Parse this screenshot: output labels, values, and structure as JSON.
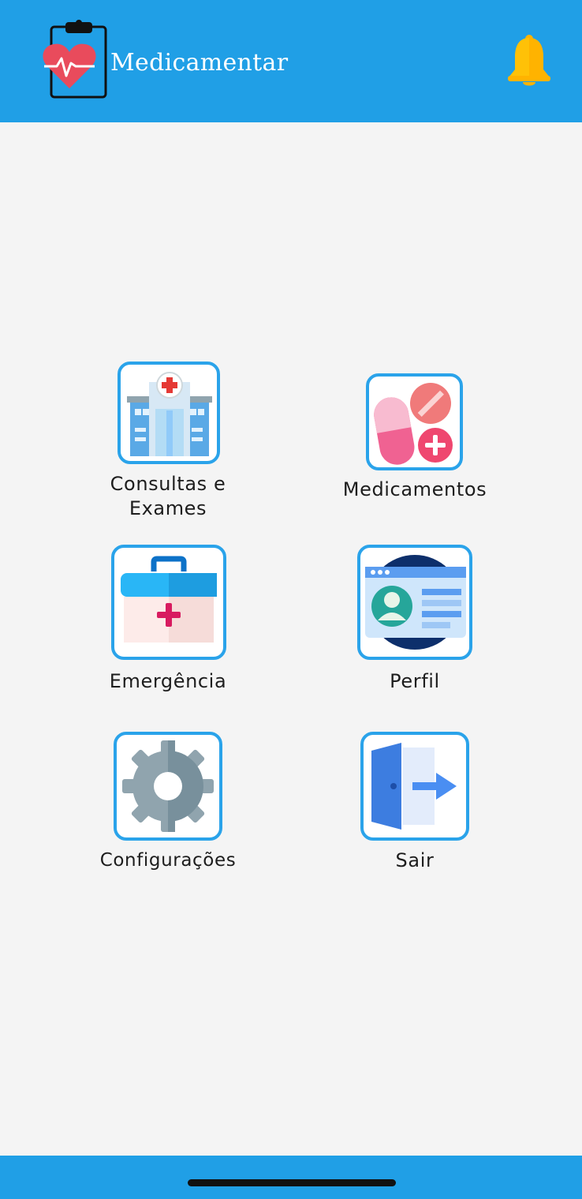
{
  "header": {
    "app_title": "Medicamentar",
    "logo_icon": "clipboard-heart-icon",
    "notification_icon": "bell-icon"
  },
  "menu": {
    "items": [
      {
        "label_line1": "Consultas e",
        "label_line2": "Exames",
        "icon": "hospital-icon"
      },
      {
        "label": "Medicamentos",
        "icon": "pills-icon"
      },
      {
        "label": "Emergência",
        "icon": "first-aid-kit-icon"
      },
      {
        "label": "Perfil",
        "icon": "id-card-icon"
      },
      {
        "label": "Configurações",
        "icon": "gear-icon"
      },
      {
        "label": "Sair",
        "icon": "exit-door-icon"
      }
    ]
  },
  "colors": {
    "primary": "#209fe6",
    "tile_border": "#2aa3ea",
    "background": "#f4f4f4",
    "bell": "#ffc107",
    "heart": "#e94b5c"
  }
}
